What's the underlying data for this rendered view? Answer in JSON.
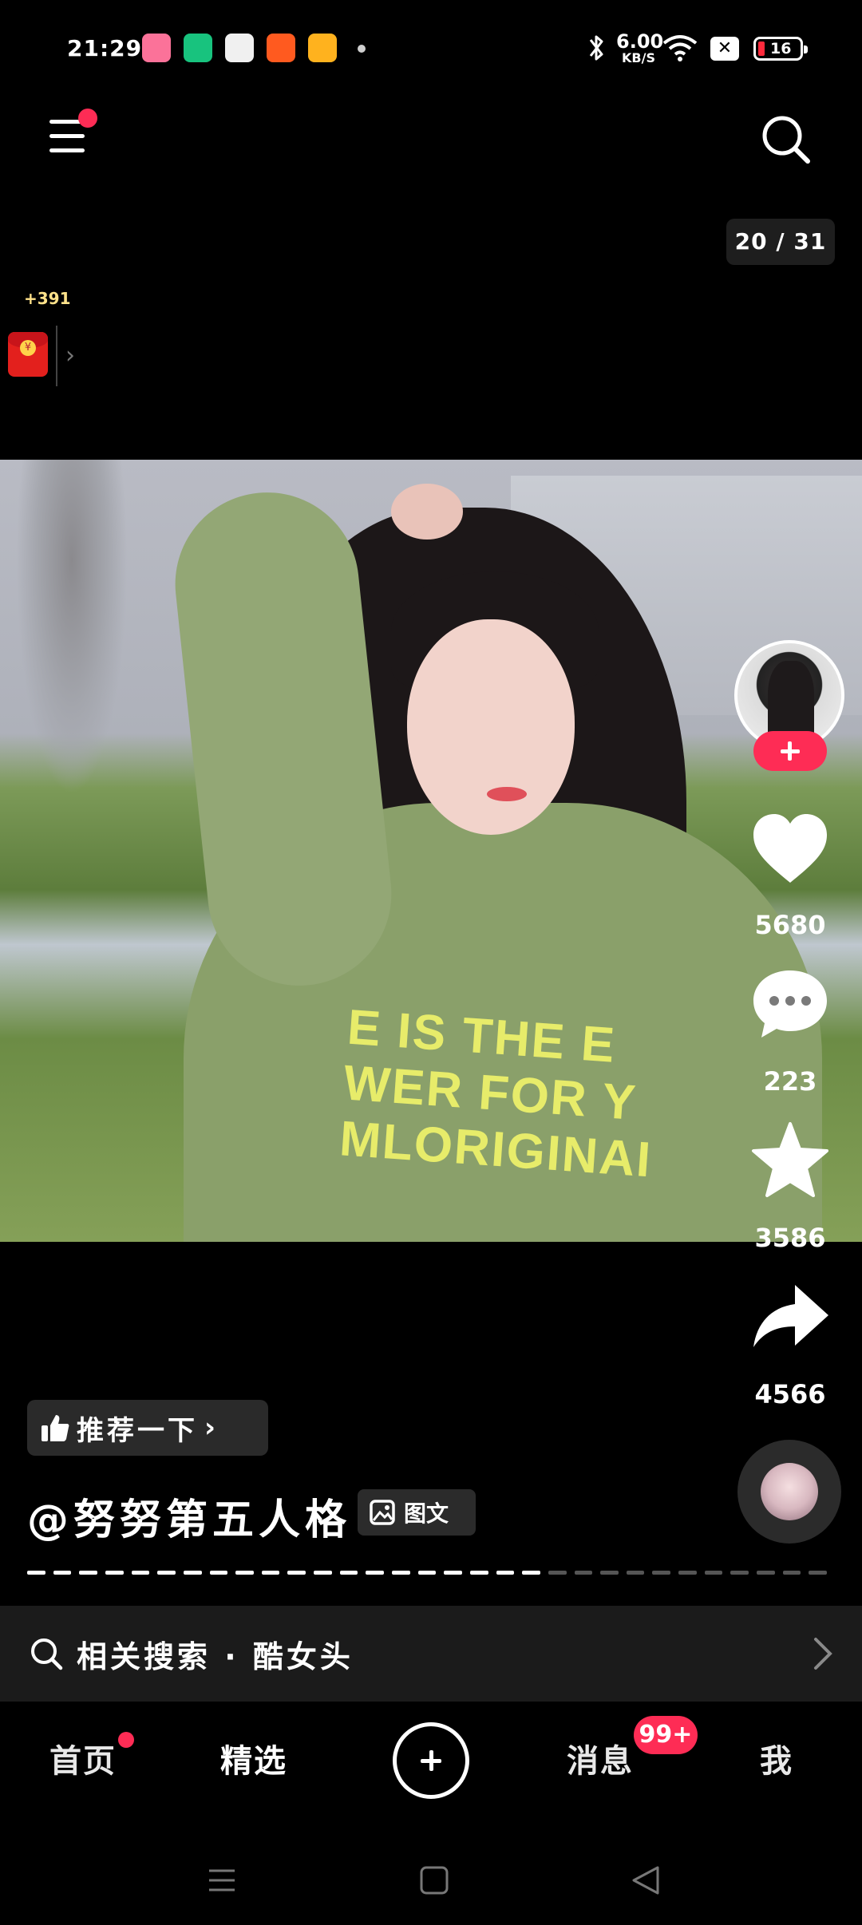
{
  "status_bar": {
    "time": "21:29",
    "net_speed_value": "6.00",
    "net_speed_unit": "KB/S",
    "battery_level": "16",
    "app_icons": [
      {
        "name": "bilibili-icon",
        "color": "#fb7299"
      },
      {
        "name": "wallet-icon",
        "color": "#18c37e"
      },
      {
        "name": "orange-app-icon",
        "color": "#f0f0f0"
      },
      {
        "name": "shopping-app-icon",
        "color": "#ff5a1f"
      },
      {
        "name": "video-app-icon",
        "color": "#ffb21e"
      }
    ]
  },
  "header": {
    "counter": "20 / 31",
    "bonus": "+391"
  },
  "photo": {
    "print_lines": [
      "E IS THE E",
      "WER FOR Y",
      "MLORIGINAI"
    ]
  },
  "actions": {
    "likes": "5680",
    "comments": "223",
    "favorites": "3586",
    "shares": "4566"
  },
  "post": {
    "recommend_label": "推荐一下",
    "author": "@努努第五人格",
    "type_tag": "图文",
    "progress_total": 31,
    "progress_current": 20
  },
  "related": {
    "label": "相关搜索 · 酷女头"
  },
  "tabs": {
    "home": "首页",
    "featured": "精选",
    "messages": "消息",
    "messages_badge": "99+",
    "me": "我"
  },
  "colors": {
    "accent": "#fe2c55",
    "background": "#000000"
  }
}
